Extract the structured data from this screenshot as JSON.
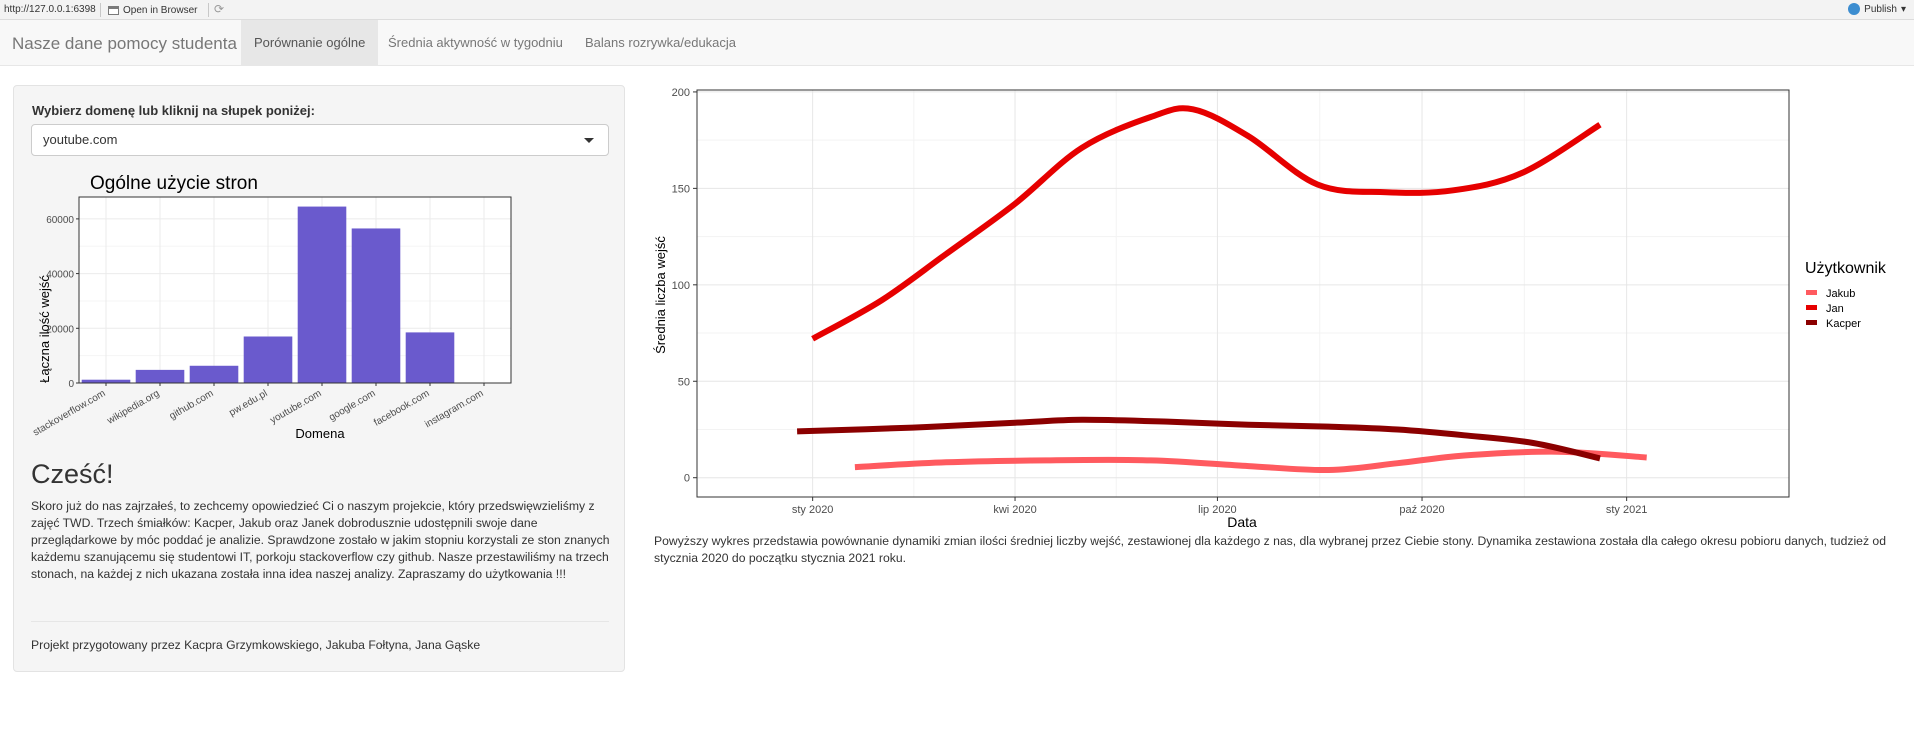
{
  "viewer": {
    "url": "http://127.0.0.1:6398",
    "open_browser": "Open in Browser",
    "publish": "Publish"
  },
  "navbar": {
    "brand": "Nasze dane pomocy studenta",
    "tabs": [
      {
        "label": "Porównanie ogólne",
        "active": true
      },
      {
        "label": "Średnia aktywność w tygodniu",
        "active": false
      },
      {
        "label": "Balans rozrywka/edukacja",
        "active": false
      }
    ]
  },
  "sidebar": {
    "select_label": "Wybierz domenę lub kliknij na słupek poniżej:",
    "select_value": "youtube.com",
    "greeting": "Cześć!",
    "description": "Skoro już do nas zajrzałeś, to zechcemy opowiedzieć Ci o naszym projekcie, który przedswięwzieliśmy z zajęć TWD. Trzech śmiałków: Kacper, Jakub oraz Janek dobrodusznie udostępnili swoje dane przeglądarkowe by móc poddać je analizie. Sprawdzone zostało w jakim stopniu korzystali ze ston znanych każdemu szanującemu się studentowi IT, porkoju stackoverflow czy github. Nasze przestawiliśmy na trzech stonach, na każdej z nich ukazana została inna idea naszej analizy. Zapraszamy do użytkowania !!!",
    "credits": "Projekt przygotowany przez Kacpra Grzymkowskiego, Jakuba Fołtyna, Jana Gąske"
  },
  "main": {
    "description": "Powyższy wykres przedstawia powównanie dynamiki zmian ilości średniej liczby wejść, zestawionej dla każdego z nas, dla wybranej przez Ciebie stony. Dynamika zestawiona została dla całego okresu pobioru danych, tudzież od stycznia 2020 do początku stycznia 2021 roku."
  },
  "colors": {
    "bar": "#6A5ACD",
    "jakub": "#ff5a5f",
    "jan": "#e60000",
    "kacper": "#8b0000"
  },
  "chart_data": [
    {
      "type": "bar",
      "title": "Ogólne użycie stron",
      "xlabel": "Domena",
      "ylabel": "Łączna ilość wejść",
      "categories": [
        "stackoverflow.com",
        "wikipedia.org",
        "github.com",
        "pw.edu.pl",
        "youtube.com",
        "google.com",
        "facebook.com",
        "instagram.com"
      ],
      "values": [
        1200,
        4800,
        6300,
        17000,
        64500,
        56500,
        18500,
        0
      ],
      "ylim": [
        0,
        68000
      ],
      "yticks": [
        0,
        20000,
        40000,
        60000
      ],
      "ytick_labels": [
        "0",
        "20000",
        "40000",
        "60000"
      ],
      "grid": true
    },
    {
      "type": "line",
      "xlabel": "Data",
      "ylabel": "Średnia liczba wejść",
      "legend_title": "Użytkownik",
      "legend_position": "right",
      "grid": true,
      "xlim": [
        "2019-11-10",
        "2021-03-15"
      ],
      "ylim": [
        -10,
        201
      ],
      "xticks": [
        "2020-01-01",
        "2020-04-01",
        "2020-07-01",
        "2020-10-01",
        "2021-01-01"
      ],
      "xtick_labels": [
        "sty 2020",
        "kwi 2020",
        "lip 2020",
        "paź 2020",
        "sty 2021"
      ],
      "yticks": [
        0,
        50,
        100,
        150,
        200
      ],
      "ytick_labels": [
        "0",
        "50",
        "100",
        "150",
        "200"
      ],
      "series": [
        {
          "name": "Jakub",
          "x": [
            "2020-01-20",
            "2020-03-01",
            "2020-04-15",
            "2020-06-01",
            "2020-07-15",
            "2020-08-20",
            "2020-09-20",
            "2020-10-20",
            "2020-12-01",
            "2021-01-10"
          ],
          "y": [
            5.5,
            8,
            9,
            9,
            6,
            4,
            7.5,
            11.5,
            13.5,
            10.5
          ]
        },
        {
          "name": "Jan",
          "x": [
            "2020-01-01",
            "2020-02-01",
            "2020-03-01",
            "2020-04-01",
            "2020-05-01",
            "2020-06-01",
            "2020-06-20",
            "2020-07-15",
            "2020-08-15",
            "2020-09-15",
            "2020-10-15",
            "2020-11-15",
            "2020-12-20"
          ],
          "y": [
            72,
            92,
            116,
            142,
            171,
            187,
            191,
            177,
            152,
            148,
            149,
            158,
            183
          ]
        },
        {
          "name": "Kacper",
          "x": [
            "2019-12-25",
            "2020-02-15",
            "2020-04-01",
            "2020-05-01",
            "2020-06-10",
            "2020-07-15",
            "2020-08-20",
            "2020-09-20",
            "2020-10-20",
            "2020-11-20",
            "2020-12-20"
          ],
          "y": [
            24,
            26,
            28.5,
            30,
            29,
            27.5,
            26.5,
            25,
            22,
            18,
            10
          ]
        }
      ]
    }
  ]
}
